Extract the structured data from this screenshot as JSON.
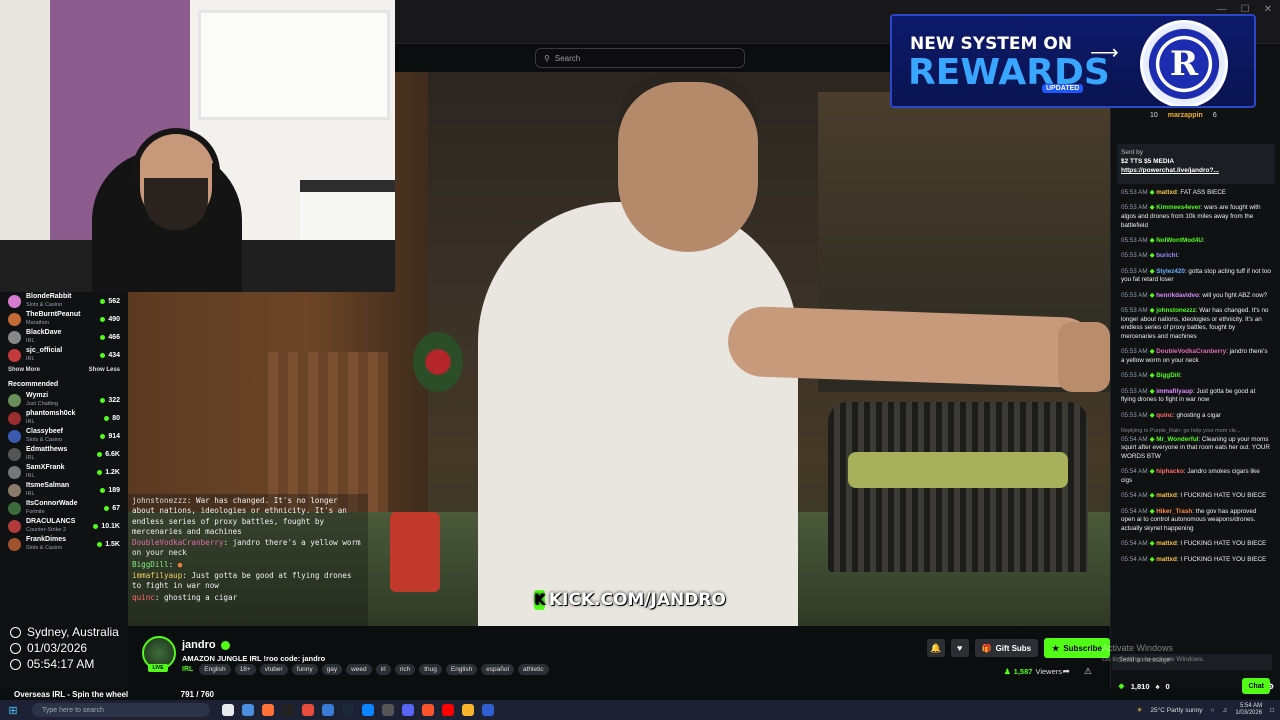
{
  "search": {
    "placeholder": "Search"
  },
  "window_controls": [
    "—",
    "☐",
    "✕"
  ],
  "webcam": {
    "label": "streamer webcam"
  },
  "rewards_banner": {
    "line1": "NEW SYSTEM ON",
    "line2": "REWARDS",
    "badge": "UPDATED",
    "chip_letter": "R"
  },
  "video": {
    "watermark": "KICK.COM/JANDRO",
    "watermark_k": "K"
  },
  "overlay_chat": [
    {
      "user": "johnstonezzz",
      "text": ": War has changed. It's no longer about nations, ideologies or ethnicity. It's an endless series of proxy battles, fought by mercenaries and machines"
    },
    {
      "user": "DoubleVodkaCranberry",
      "text": ": jandro there's a yellow worm on your neck"
    },
    {
      "user": "BiggDill",
      "text": ":"
    },
    {
      "user": "immafilyaup",
      "text": ": Just gotta be good at flying drones to fight in war now"
    },
    {
      "user": "quinc",
      "text": ": ghosting a cigar"
    }
  ],
  "sidebar": {
    "following": [
      {
        "name": "BlondeRabbit",
        "cat": "Slots & Casino",
        "viewers": "562",
        "color": "#d77bd1"
      },
      {
        "name": "TheBurntPeanut",
        "cat": "Marathon",
        "viewers": "490",
        "color": "#c46a36"
      },
      {
        "name": "BlackDave",
        "cat": "IRL",
        "viewers": "466",
        "color": "#888888"
      },
      {
        "name": "sjc_official",
        "cat": "IRL",
        "viewers": "434",
        "color": "#c23a3a"
      }
    ],
    "show_more": "Show More",
    "show_less": "Show Less",
    "recommended_title": "Recommended",
    "recommended": [
      {
        "name": "Wymzi",
        "cat": "Just Chatting",
        "viewers": "322",
        "color": "#6b8f5a"
      },
      {
        "name": "phantomsh0ck",
        "cat": "IRL",
        "viewers": "80",
        "color": "#9a2d2d"
      },
      {
        "name": "Classybeef",
        "cat": "Slots & Casino",
        "viewers": "914",
        "color": "#3a5ab0"
      },
      {
        "name": "Edmatthews",
        "cat": "IRL",
        "viewers": "6.6K",
        "color": "#555555"
      },
      {
        "name": "SamXFrank",
        "cat": "IRL",
        "viewers": "1.2K",
        "color": "#777777"
      },
      {
        "name": "ItsmeSalman",
        "cat": "IRL",
        "viewers": "189",
        "color": "#8a7a6a"
      },
      {
        "name": "ItsConnorWade",
        "cat": "Fortnite",
        "viewers": "67",
        "color": "#3b6b3b"
      },
      {
        "name": "DRACULANCS",
        "cat": "Counter-Strike 2",
        "viewers": "10.1K",
        "color": "#b23a3a"
      },
      {
        "name": "FrankDimes",
        "cat": "Slots & Casino",
        "viewers": "1.5K",
        "color": "#a0522d"
      }
    ]
  },
  "location_overlay": {
    "city": "Sydney, Australia",
    "date": "01/03/2026",
    "time": "05:54:17 AM"
  },
  "goal": {
    "label": "Overseas IRL - Spin the wheel",
    "count": "791 / 760",
    "fraction": 1.0
  },
  "stream_info": {
    "channel": "jandro",
    "title": "AMAZON JUNGLE IRL !roo code: jandro",
    "category": "IRL",
    "live_label": "LIVE",
    "tags": [
      "English",
      "18+",
      "vtuber",
      "funny",
      "gay",
      "weed",
      "irl",
      "rich",
      "thug",
      "English",
      "español",
      "athletic"
    ],
    "gift_subs": "Gift Subs",
    "subscribe": "Subscribe",
    "viewers": "1,587",
    "viewers_label": "Viewers"
  },
  "chat": {
    "top_users": [
      {
        "name": "",
        "count": "10"
      },
      {
        "name": "marzappin",
        "count": "6"
      }
    ],
    "pinned": {
      "line1": "Sent by",
      "line2": "$2 TTS $5 MEDIA",
      "link": "https://powerchat.live/jandro?..."
    },
    "messages": [
      {
        "time": "05:53 AM",
        "user": "mattxd",
        "color": "#f5c542",
        "text": ": FAT ASS BIECE"
      },
      {
        "time": "05:53 AM",
        "user": "Kimmees4ever",
        "color": "#53fc18",
        "text": ": wars are fought with algos and drones from 10k miles away from the battlefield"
      },
      {
        "time": "05:53 AM",
        "user": "NoIWontMod4U",
        "color": "#53fc18",
        "text": ":"
      },
      {
        "time": "05:53 AM",
        "user": "burichi",
        "color": "#9b8cff",
        "text": ":"
      },
      {
        "time": "05:53 AM",
        "user": "Stylez420",
        "color": "#6ab0ff",
        "text": ": gotta stop acting tuff if not too you fat retard loser"
      },
      {
        "time": "05:53 AM",
        "user": "henrikdavidvo",
        "color": "#d98cff",
        "text": ": will you fight ABZ now?"
      },
      {
        "time": "05:53 AM",
        "user": "johnstonezzz",
        "color": "#53fc18",
        "text": ": War has changed. It's no longer about nations, ideologies or ethnicity. It's an endless series of proxy battles, fought by mercenaries and machines"
      },
      {
        "time": "05:53 AM",
        "user": "DoubleVodkaCranberry",
        "color": "#e06bb0",
        "text": ": jandro there's a yellow worm on your neck"
      },
      {
        "time": "05:53 AM",
        "user": "BiggDill",
        "color": "#53fc18",
        "text": ":"
      },
      {
        "time": "05:53 AM",
        "user": "immafilyaup",
        "color": "#d98cff",
        "text": ": Just gotta be good at flying drones to fight in war now"
      },
      {
        "time": "05:53 AM",
        "user": "quinc",
        "color": "#ff6a6a",
        "text": ": ghosting a cigar"
      },
      {
        "time": "05:54 AM",
        "user": "Mr_Wonderful",
        "color": "#53fc18",
        "text": ": Cleaning up your moms squirt after everyone in that room eats her out. YOUR WORDS BTW",
        "reply": "Replying to Purple_Rain: go help your mom cle..."
      },
      {
        "time": "05:54 AM",
        "user": "hiphacko",
        "color": "#ff6a6a",
        "text": ": Jandro smokes cigars like cigs"
      },
      {
        "time": "05:54 AM",
        "user": "mattxd",
        "color": "#f5c542",
        "text": ": I FUCKING HATE YOU BIECE"
      },
      {
        "time": "05:54 AM",
        "user": "Hiker_Trash",
        "color": "#ff8c42",
        "text": ": the gov has approved open ai to control autonomous weapons/drones. actually skynet happening"
      },
      {
        "time": "05:54 AM",
        "user": "mattxd",
        "color": "#f5c542",
        "text": ": I FUCKING HATE YOU BIECE"
      },
      {
        "time": "05:54 AM",
        "user": "mattxd",
        "color": "#f5c542",
        "text": ": I FUCKING HATE YOU BIECE"
      }
    ],
    "input_placeholder": "Send a message",
    "points": "1,810",
    "sub_count": "0",
    "chat_button": "Chat"
  },
  "activation": {
    "title": "Activate Windows",
    "sub": "Go to Settings to activate Windows."
  },
  "taskbar": {
    "search_placeholder": "Type here to search",
    "weather": "25°C  Partly sunny",
    "time": "5:54 AM",
    "date": "1/03/2026"
  }
}
